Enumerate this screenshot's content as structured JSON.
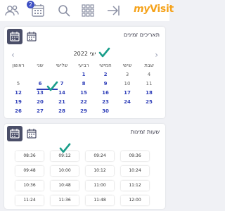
{
  "topbar": {
    "badge_count": "2",
    "logo_my": "my",
    "logo_visit": "Visit"
  },
  "calendar_card": {
    "title": "תאריכים זמינים",
    "month_label": "יוני 2022",
    "weekdays": [
      "ראשון",
      "שני",
      "שלישי",
      "רביעי",
      "חמישי",
      "שישי",
      "שבת"
    ],
    "dates": [
      [
        "",
        "",
        "",
        "1",
        "2",
        "3",
        "4"
      ],
      [
        "5",
        "6",
        "7",
        "8",
        "9",
        "10",
        "11"
      ],
      [
        "12",
        "13",
        "14",
        "15",
        "16",
        "17",
        "18"
      ],
      [
        "19",
        "20",
        "21",
        "22",
        "23",
        "24",
        "25"
      ],
      [
        "26",
        "27",
        "28",
        "29",
        "30",
        "",
        ""
      ]
    ],
    "selected_date": "13"
  },
  "times_card": {
    "title": "שעות זמינות",
    "slots": [
      [
        "08:36",
        "09:12",
        "09:24",
        "09:36"
      ],
      [
        "09:48",
        "10:00",
        "10:12",
        "10:24"
      ],
      [
        "10:36",
        "10:48",
        "11:00",
        "11:12"
      ],
      [
        "11:24",
        "11:36",
        "11:48",
        "12:00"
      ]
    ],
    "selected_slot": "09:12"
  },
  "colors": {
    "accent": "#2d3db8",
    "logo": "#f5a21a",
    "check": "#1a9e8a",
    "icon_dark": "#4a4e68"
  },
  "icons": [
    "users-icon",
    "calendar-icon",
    "search-icon",
    "grid-icon",
    "login-arrow-icon",
    "calendar-dark-icon",
    "calendar-light-icon",
    "checkmark-icon"
  ]
}
